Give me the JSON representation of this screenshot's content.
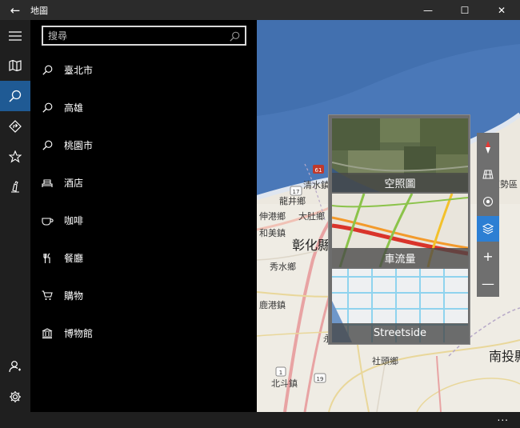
{
  "window": {
    "title": "地圖",
    "back_glyph": "←",
    "minimize_glyph": "—",
    "maximize_glyph": "☐",
    "close_glyph": "✕"
  },
  "rail": {
    "items": [
      {
        "name": "hamburger-menu-icon"
      },
      {
        "name": "map-icon"
      },
      {
        "name": "search-icon",
        "active": true
      },
      {
        "name": "directions-icon"
      },
      {
        "name": "favorites-star-icon"
      },
      {
        "name": "ink-pen-icon"
      }
    ],
    "bottom": [
      {
        "name": "account-icon"
      },
      {
        "name": "settings-gear-icon"
      }
    ]
  },
  "search": {
    "placeholder": "搜尋",
    "value": ""
  },
  "results": [
    {
      "label": "臺北市",
      "icon": "search-icon"
    },
    {
      "label": "高雄",
      "icon": "search-icon"
    },
    {
      "label": "桃園市",
      "icon": "search-icon"
    },
    {
      "label": "酒店",
      "icon": "hotel-bed-icon"
    },
    {
      "label": "咖啡",
      "icon": "coffee-cup-icon"
    },
    {
      "label": "餐廳",
      "icon": "restaurant-utensils-icon"
    },
    {
      "label": "購物",
      "icon": "shopping-cart-icon"
    },
    {
      "label": "博物館",
      "icon": "museum-icon"
    }
  ],
  "map": {
    "labels": [
      {
        "text": "清水鎮"
      },
      {
        "text": "龍井鄉"
      },
      {
        "text": "伸港鄉"
      },
      {
        "text": "大肚鄉"
      },
      {
        "text": "和美鎮"
      },
      {
        "text": "彰化縣"
      },
      {
        "text": "秀水鄉"
      },
      {
        "text": "鹿港鎮"
      },
      {
        "text": "永"
      },
      {
        "text": "社頭鄉"
      },
      {
        "text": "北斗鎮"
      },
      {
        "text": "南投縣"
      },
      {
        "text": "東勢區"
      }
    ],
    "road_shields": [
      "61",
      "17",
      "1",
      "19"
    ]
  },
  "layers": {
    "tiles": [
      {
        "label": "空照圖"
      },
      {
        "label": "車流量"
      },
      {
        "label": "Streetside"
      }
    ]
  },
  "controls": {
    "zoom_in": "+",
    "zoom_out": "—"
  },
  "status": {
    "more": "..."
  },
  "colors": {
    "accent": "#2d7fd3",
    "rail_active": "#1f5a94",
    "sea": "#4a78b8"
  }
}
